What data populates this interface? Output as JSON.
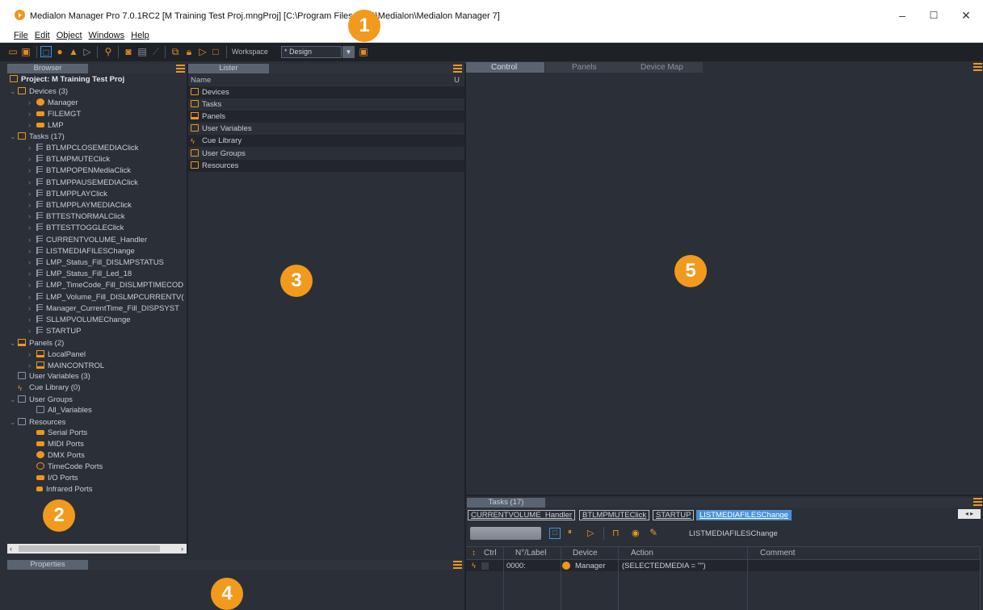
{
  "window": {
    "title": "Medialon Manager Pro 7.0.1RC2  [M Training Test Proj.mngProj] [C:\\Program Files (x86)\\Medialon\\Medialon Manager 7]",
    "controls": {
      "minimize": "–",
      "maximize": "☐",
      "close": "✕"
    }
  },
  "menu": [
    "File",
    "Edit",
    "Object",
    "Windows",
    "Help"
  ],
  "toolbar": {
    "workspace_label": "Workspace",
    "workspace_value": "* Design",
    "icons": [
      "open-folder-icon",
      "save-icon",
      "select-icon",
      "run-icon",
      "user-icon",
      "play-icon",
      "search-icon",
      "device-icon",
      "window-icon",
      "wand-icon",
      "link-icon",
      "lock-icon",
      "play-outline-icon",
      "stop-icon",
      "workspace-save-icon"
    ]
  },
  "browser": {
    "header": "Browser",
    "project": "Project: M Training Test Proj",
    "devices": {
      "label": "Devices (3)",
      "items": [
        "Manager",
        "FILEMGT",
        "LMP"
      ]
    },
    "tasks": {
      "label": "Tasks (17)",
      "items": [
        "BTLMPCLOSEMEDIAClick",
        "BTLMPMUTEClick",
        "BTLMPOPENMediaClick",
        "BTLMPPAUSEMEDIAClick",
        "BTLMPPLAYClick",
        "BTLMPPLAYMEDIAClick",
        "BTTESTNORMALClick",
        "BTTESTTOGGLEClick",
        "CURRENTVOLUME_Handler",
        "LISTMEDIAFILESChange",
        "LMP_Status_Fill_DISLMPSTATUS",
        "LMP_Status_Fill_Led_18",
        "LMP_TimeCode_Fill_DISLMPTIMECOD",
        "LMP_Volume_Fill_DISLMPCURRENTV(",
        "Manager_CurrentTime_Fill_DISPSYST",
        "SLLMPVOLUMEChange",
        "STARTUP"
      ]
    },
    "panels": {
      "label": "Panels (2)",
      "items": [
        "LocalPanel",
        "MAINCONTROL"
      ]
    },
    "user_variables": "User Variables (3)",
    "cue_library": "Cue Library (0)",
    "user_groups": {
      "label": "User Groups",
      "items": [
        "All_Variables"
      ]
    },
    "resources": {
      "label": "Resources",
      "items": [
        "Serial Ports",
        "MIDI Ports",
        "DMX Ports",
        "TimeCode Ports",
        "I/O Ports",
        "Infrared Ports"
      ]
    }
  },
  "lister": {
    "header": "Lister",
    "col_name": "Name",
    "col_u": "U",
    "rows": [
      "Devices",
      "Tasks",
      "Panels",
      "User Variables",
      "Cue Library",
      "User Groups",
      "Resources"
    ]
  },
  "properties": {
    "header": "Properties"
  },
  "control": {
    "tabs": [
      "Control",
      "Panels",
      "Device Map"
    ]
  },
  "tasks_panel": {
    "header": "Tasks (17)",
    "open_tabs": [
      "CURRENTVOLUME_Handler",
      "BTLMPMUTEClick",
      "STARTUP",
      "LISTMEDIAFILESChange"
    ],
    "current_task": "LISTMEDIAFILESChange",
    "columns": [
      "Ctrl",
      "N°/Label",
      "Device",
      "Action",
      "Comment"
    ],
    "row": {
      "label": "0000:",
      "device": "Manager",
      "action": "(SELECTEDMEDIA = \"\")",
      "comment": ""
    }
  },
  "callouts": [
    "1",
    "2",
    "3",
    "4",
    "5"
  ],
  "colors": {
    "accent": "#f0961e",
    "panel_bg": "#2b3038",
    "header_bg": "#5a6471",
    "selected_tab": "#4a90d9"
  }
}
